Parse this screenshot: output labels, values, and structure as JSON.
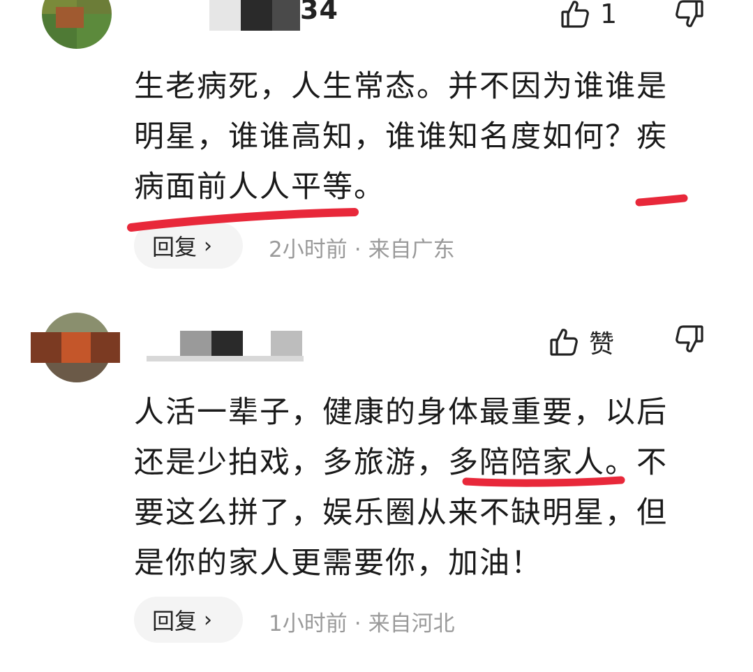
{
  "comments": [
    {
      "username_tail": "34",
      "like_count": "1",
      "lines": [
        "生老病死，人生常态。并不因为谁谁是",
        "明星，谁谁高知，谁谁知名度如何？疾",
        "病面前人人平等。"
      ],
      "reply_label": "回复",
      "reply_chevron": "›",
      "time": "2小时前",
      "separator": "·",
      "location": "来自广东"
    },
    {
      "username_tail": "",
      "like_count": "赞",
      "lines": [
        "人活一辈子，健康的身体最重要，以后",
        "还是少拍戏，多旅游，多陪陪家人。不",
        "要这么拼了，娱乐圈从来不缺明星，但",
        "是你的家人更需要你，加油！"
      ],
      "reply_label": "回复",
      "reply_chevron": "›",
      "time": "1小时前",
      "separator": "·",
      "location": "来自河北"
    }
  ],
  "icons": {
    "like": "thumbs-up-icon",
    "dislike": "thumbs-down-icon"
  },
  "colors": {
    "text": "#1a1a1a",
    "meta": "#9a9a9a",
    "reply_bg": "#f4f4f4",
    "underline": "#e8283a"
  }
}
